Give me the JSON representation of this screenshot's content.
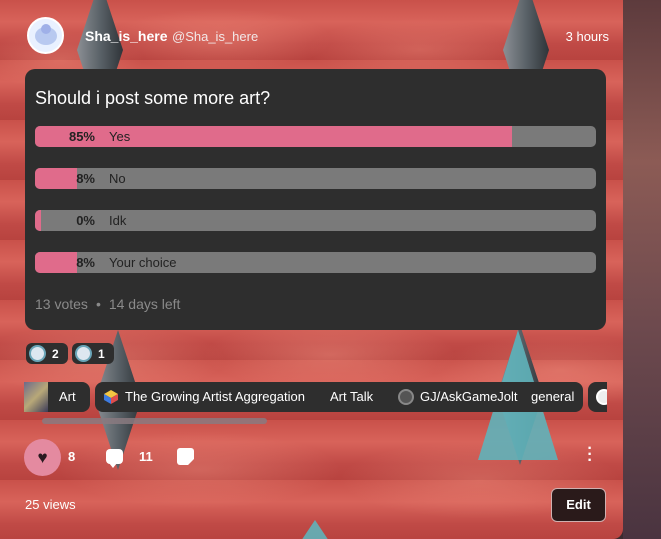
{
  "post": {
    "author_name": "Sha_is_here",
    "author_handle": "@Sha_is_here",
    "timestamp": "3 hours"
  },
  "poll": {
    "question": "Should i post some more art?",
    "options": [
      {
        "percent": "85%",
        "label": "Yes",
        "fill": 0.85
      },
      {
        "percent": "8%",
        "label": "No",
        "fill": 0.075
      },
      {
        "percent": "0%",
        "label": "Idk",
        "fill": 0.01
      },
      {
        "percent": "8%",
        "label": "Your choice",
        "fill": 0.075
      }
    ],
    "votes": "13 votes",
    "time_left": "14 days left"
  },
  "reactions": [
    {
      "icon": "emoji-face-icon",
      "count": "2"
    },
    {
      "icon": "emoji-cheer-icon",
      "count": "1"
    }
  ],
  "tags": [
    {
      "label": "Art",
      "icon": "art-thumb-icon"
    },
    {
      "label": "The Growing Artist Aggregation",
      "icon": "cube-icon"
    },
    {
      "label": "Art Talk",
      "icon": ""
    },
    {
      "label": "GJ/AskGameJolt",
      "icon": "circle-icon"
    },
    {
      "label": "general",
      "icon": ""
    }
  ],
  "actions": {
    "likes": "8",
    "comments": "11"
  },
  "footer": {
    "views": "25 views",
    "edit_label": "Edit"
  },
  "colors": {
    "poll_fill": "#e06b8b",
    "poll_track": "#7a7a7a",
    "panel": "#2e2e2e",
    "like_button": "#e48aa0"
  }
}
